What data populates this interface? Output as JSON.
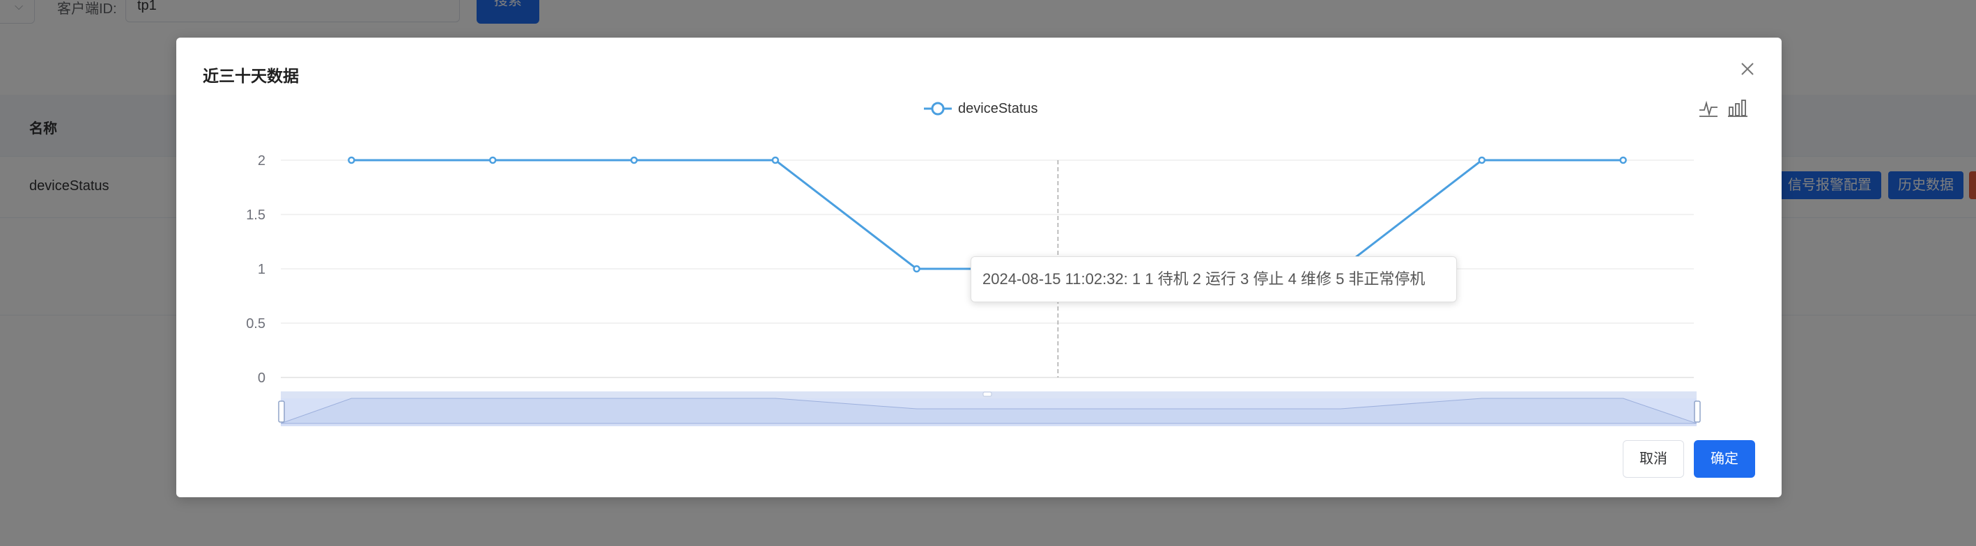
{
  "background": {
    "client_id_label": "客户端ID:",
    "client_id_value": "tp1",
    "search_button": "搜索",
    "table": {
      "header_name": "名称",
      "row_name": "deviceStatus",
      "actions": [
        "信号报警配置",
        "历史数据"
      ]
    }
  },
  "dialog": {
    "title": "近三十天数据",
    "cancel_button": "取消",
    "ok_button": "确定",
    "tooltip": "2024-08-15 11:02:32: 1 1 待机 2 运行 3 停止 4 维修 5 非正常停机",
    "toolbox": [
      "line-chart-icon",
      "bar-chart-icon"
    ]
  },
  "colors": {
    "primary": "#1e6cf0",
    "series": "#4a9fe0",
    "mask": "rgba(0,0,0,0.5)"
  },
  "chart_data": {
    "type": "line",
    "legend": [
      "deviceStatus"
    ],
    "legend_position": "top-center",
    "y_ticks": [
      "0",
      "0.5",
      "1",
      "1.5",
      "2"
    ],
    "ylim": [
      0,
      2
    ],
    "grid": true,
    "series": [
      {
        "name": "deviceStatus",
        "values": [
          2,
          2,
          2,
          2,
          1,
          1,
          1,
          1,
          2,
          2
        ]
      }
    ],
    "hover_index": 5,
    "datazoom": true
  }
}
